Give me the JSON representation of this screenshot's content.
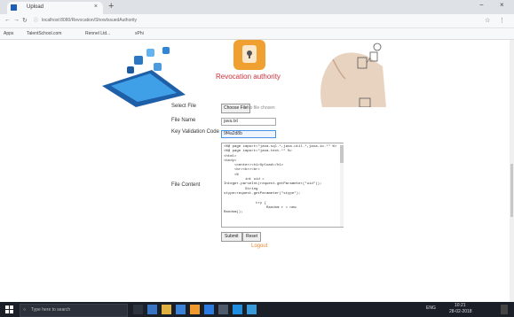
{
  "browser": {
    "tab_title": "Upload",
    "tab_close": "×",
    "new_tab": "+",
    "window_min": "−",
    "window_close": "×",
    "address": "localhost:8080/Revocation/ShowIssuedAuthority",
    "address_prefix": "ⓘ",
    "bookmarks": [
      "Apps",
      "TalentSchool.com",
      "Rennel Ltd...",
      "sPhi"
    ]
  },
  "banner": {
    "caption": "Revocation authority"
  },
  "slider": {
    "dots": 2,
    "active_index": 1
  },
  "form": {
    "select_file_label": "Select File",
    "choose_button": "Choose File",
    "no_file_text": "No file chosen",
    "file_name_label": "File Name",
    "file_name_value": "java.txt",
    "key_label": "Key Validation Code",
    "key_value": "9f4a2d8b",
    "content_label": "File Content",
    "content_text": "<%@ page import=\"java.sql.*,java.util.*,java.io.*\" %>\n<%@ page import=\"java.text.*\" %>\n<html>\n<body>\n     <center><h1>Upload</h1>\n     <br><br><br>\n     <%\n          int uid =\nInteger.parseInt(request.getParameter(\"uid\"));\n          String\nstype=request.getParameter(\"stype\");\n\n               try {\n                    Random r = new\nRandom();",
    "submit_label": "Submit",
    "reset_label": "Reset",
    "back_link": "Logout"
  },
  "taskbar": {
    "search_placeholder": "Type here to search",
    "tray_text": "ENG",
    "time": "10:21",
    "date": "28-02-2018"
  },
  "colors": {
    "accent": "#4a90e2",
    "link": "#e8842e",
    "banner_text": "#d0303a",
    "taskbar": "#1b1f28"
  }
}
